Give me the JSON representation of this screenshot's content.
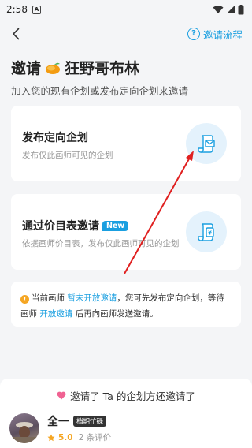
{
  "status_bar": {
    "time": "2:58",
    "app_badge": "A"
  },
  "nav": {
    "flow_label": "邀请流程"
  },
  "header": {
    "title_prefix": "邀请",
    "title_name": "狂野哥布林",
    "subtitle": "加入您的现有企划或发布定向企划来邀请"
  },
  "cards": [
    {
      "title": "发布定向企划",
      "desc": "发布仅此画师可见的企划"
    },
    {
      "title": "通过价目表邀请",
      "badge": "New",
      "desc": "依据画师价目表，发布仅此画师可见的企划"
    }
  ],
  "notice": {
    "icon": "!",
    "text_1": "当前画师",
    "link_1": "暂未开放邀请",
    "text_2": "，您可先发布定向企划，等待画师",
    "link_2": "开放邀请",
    "text_3": "后再向画师发送邀请。"
  },
  "invited": {
    "label": "邀请了 Ta 的企划方还邀请了"
  },
  "artist": {
    "name": "全一",
    "status": "档期忙碌",
    "rating": "5.0",
    "reviews": "2 条评价"
  },
  "colors": {
    "accent": "#1a9fe0",
    "star": "#f5a623",
    "arrow": "#e02020"
  }
}
